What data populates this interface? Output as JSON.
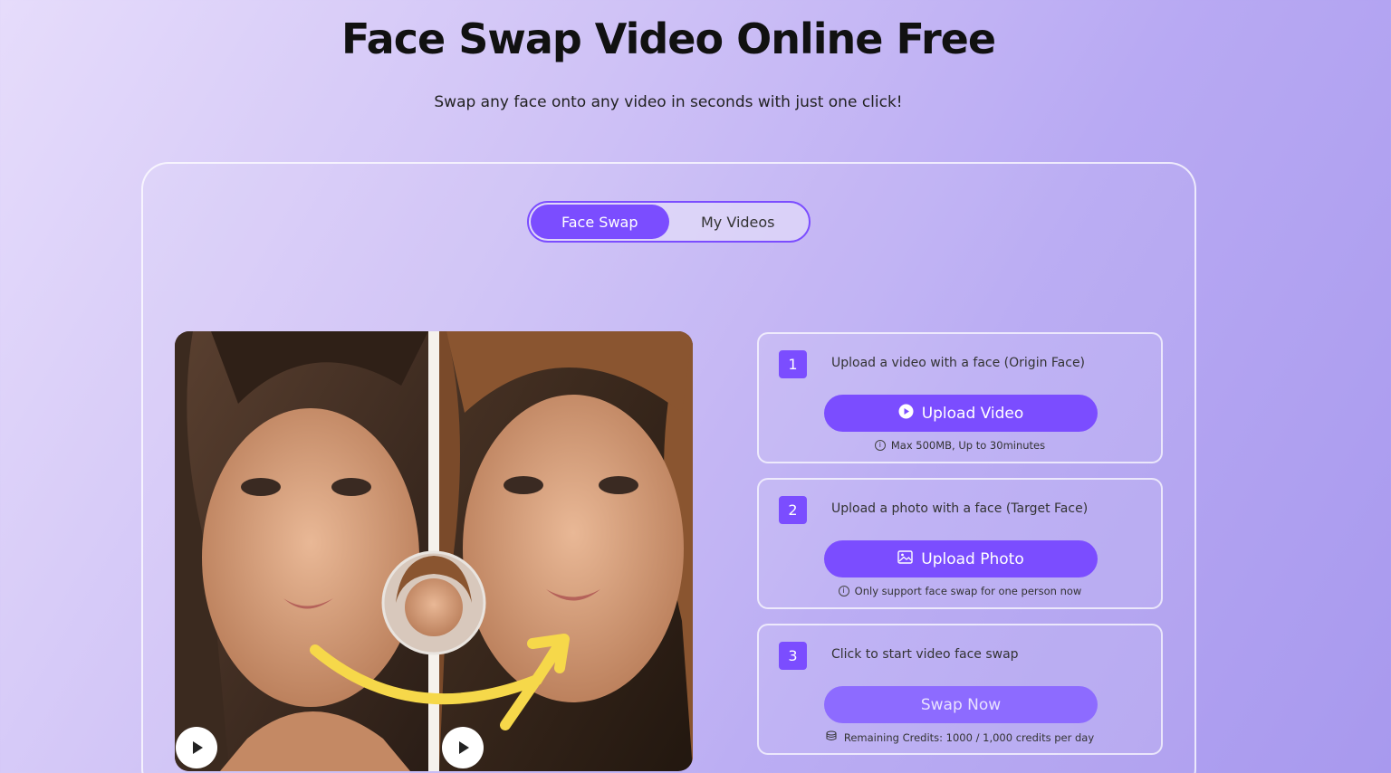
{
  "header": {
    "title": "Face Swap Video Online Free",
    "subtitle": "Swap any face onto any video in seconds with just one click!"
  },
  "tabs": [
    {
      "label": "Face Swap",
      "active": true
    },
    {
      "label": "My Videos",
      "active": false
    }
  ],
  "steps": [
    {
      "number": "1",
      "text": "Upload a video with a face  (Origin Face)",
      "button_label": "Upload Video",
      "button_icon": "play-circle-icon",
      "note_icon": "info-icon",
      "note": "Max 500MB, Up to 30minutes"
    },
    {
      "number": "2",
      "text": "Upload a photo with a face  (Target Face)",
      "button_label": "Upload Photo",
      "button_icon": "image-icon",
      "note_icon": "info-icon",
      "note": "Only support face swap for one person now"
    },
    {
      "number": "3",
      "text": "Click to start video face swap",
      "button_label": "Swap Now",
      "note_icon": "credits-icon",
      "note": "Remaining Credits:  1000 / 1,000 credits per day"
    }
  ],
  "colors": {
    "accent": "#7b4dff",
    "arrow": "#f6d84a"
  }
}
